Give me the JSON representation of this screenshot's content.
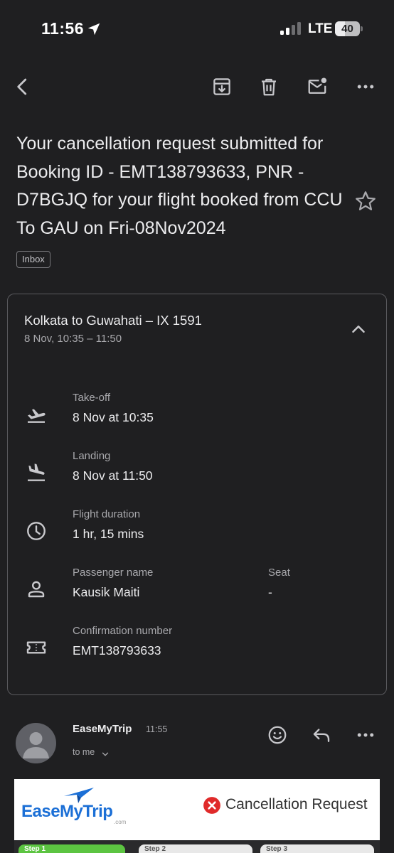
{
  "status_bar": {
    "time": "11:56",
    "network": "LTE",
    "battery": "40",
    "battery_level_percent": 40
  },
  "toolbar": {
    "back_icon": "chevron-left-icon",
    "archive_icon": "archive-icon",
    "delete_icon": "trash-icon",
    "unread_icon": "mark-unread-icon",
    "more_icon": "more-horizontal-icon"
  },
  "email": {
    "subject": "Your cancellation request submitted for Booking ID - EMT138793633, PNR - D7BGJQ for your flight booked from  CCU To GAU on Fri-08Nov2024",
    "label": "Inbox"
  },
  "flight_card": {
    "title": "Kolkata to Guwahati – IX 1591",
    "subtitle": "8 Nov, 10:35 – 11:50",
    "rows": [
      {
        "icon": "flight-takeoff-icon",
        "label": "Take-off",
        "value": "8 Nov at 10:35"
      },
      {
        "icon": "flight-land-icon",
        "label": "Landing",
        "value": "8 Nov at 11:50"
      },
      {
        "icon": "clock-icon",
        "label": "Flight duration",
        "value": "1 hr, 15 mins"
      },
      {
        "icon": "person-icon",
        "label": "Passenger name",
        "value": "Kausik Maiti",
        "label2": "Seat",
        "value2": "-"
      },
      {
        "icon": "ticket-icon",
        "label": "Confirmation number",
        "value": "EMT138793633"
      }
    ]
  },
  "sender": {
    "name": "EaseMyTrip",
    "time": "11:55",
    "to": "to me",
    "actions": [
      "emoji-react-icon",
      "reply-icon",
      "more-horizontal-icon"
    ]
  },
  "email_body": {
    "logo_text": "EaseMyTrip",
    "logo_suffix": ".com",
    "heading": "Cancellation Request",
    "steps": [
      "Step 1",
      "Step 2",
      "Step 3"
    ]
  },
  "colors": {
    "background": "#1f1f21",
    "text": "#ececee",
    "muted_text": "#a9a9ad",
    "logo_blue": "#1b6fd6",
    "cancel_red": "#e02a2a",
    "step_green": "#5cc441"
  }
}
